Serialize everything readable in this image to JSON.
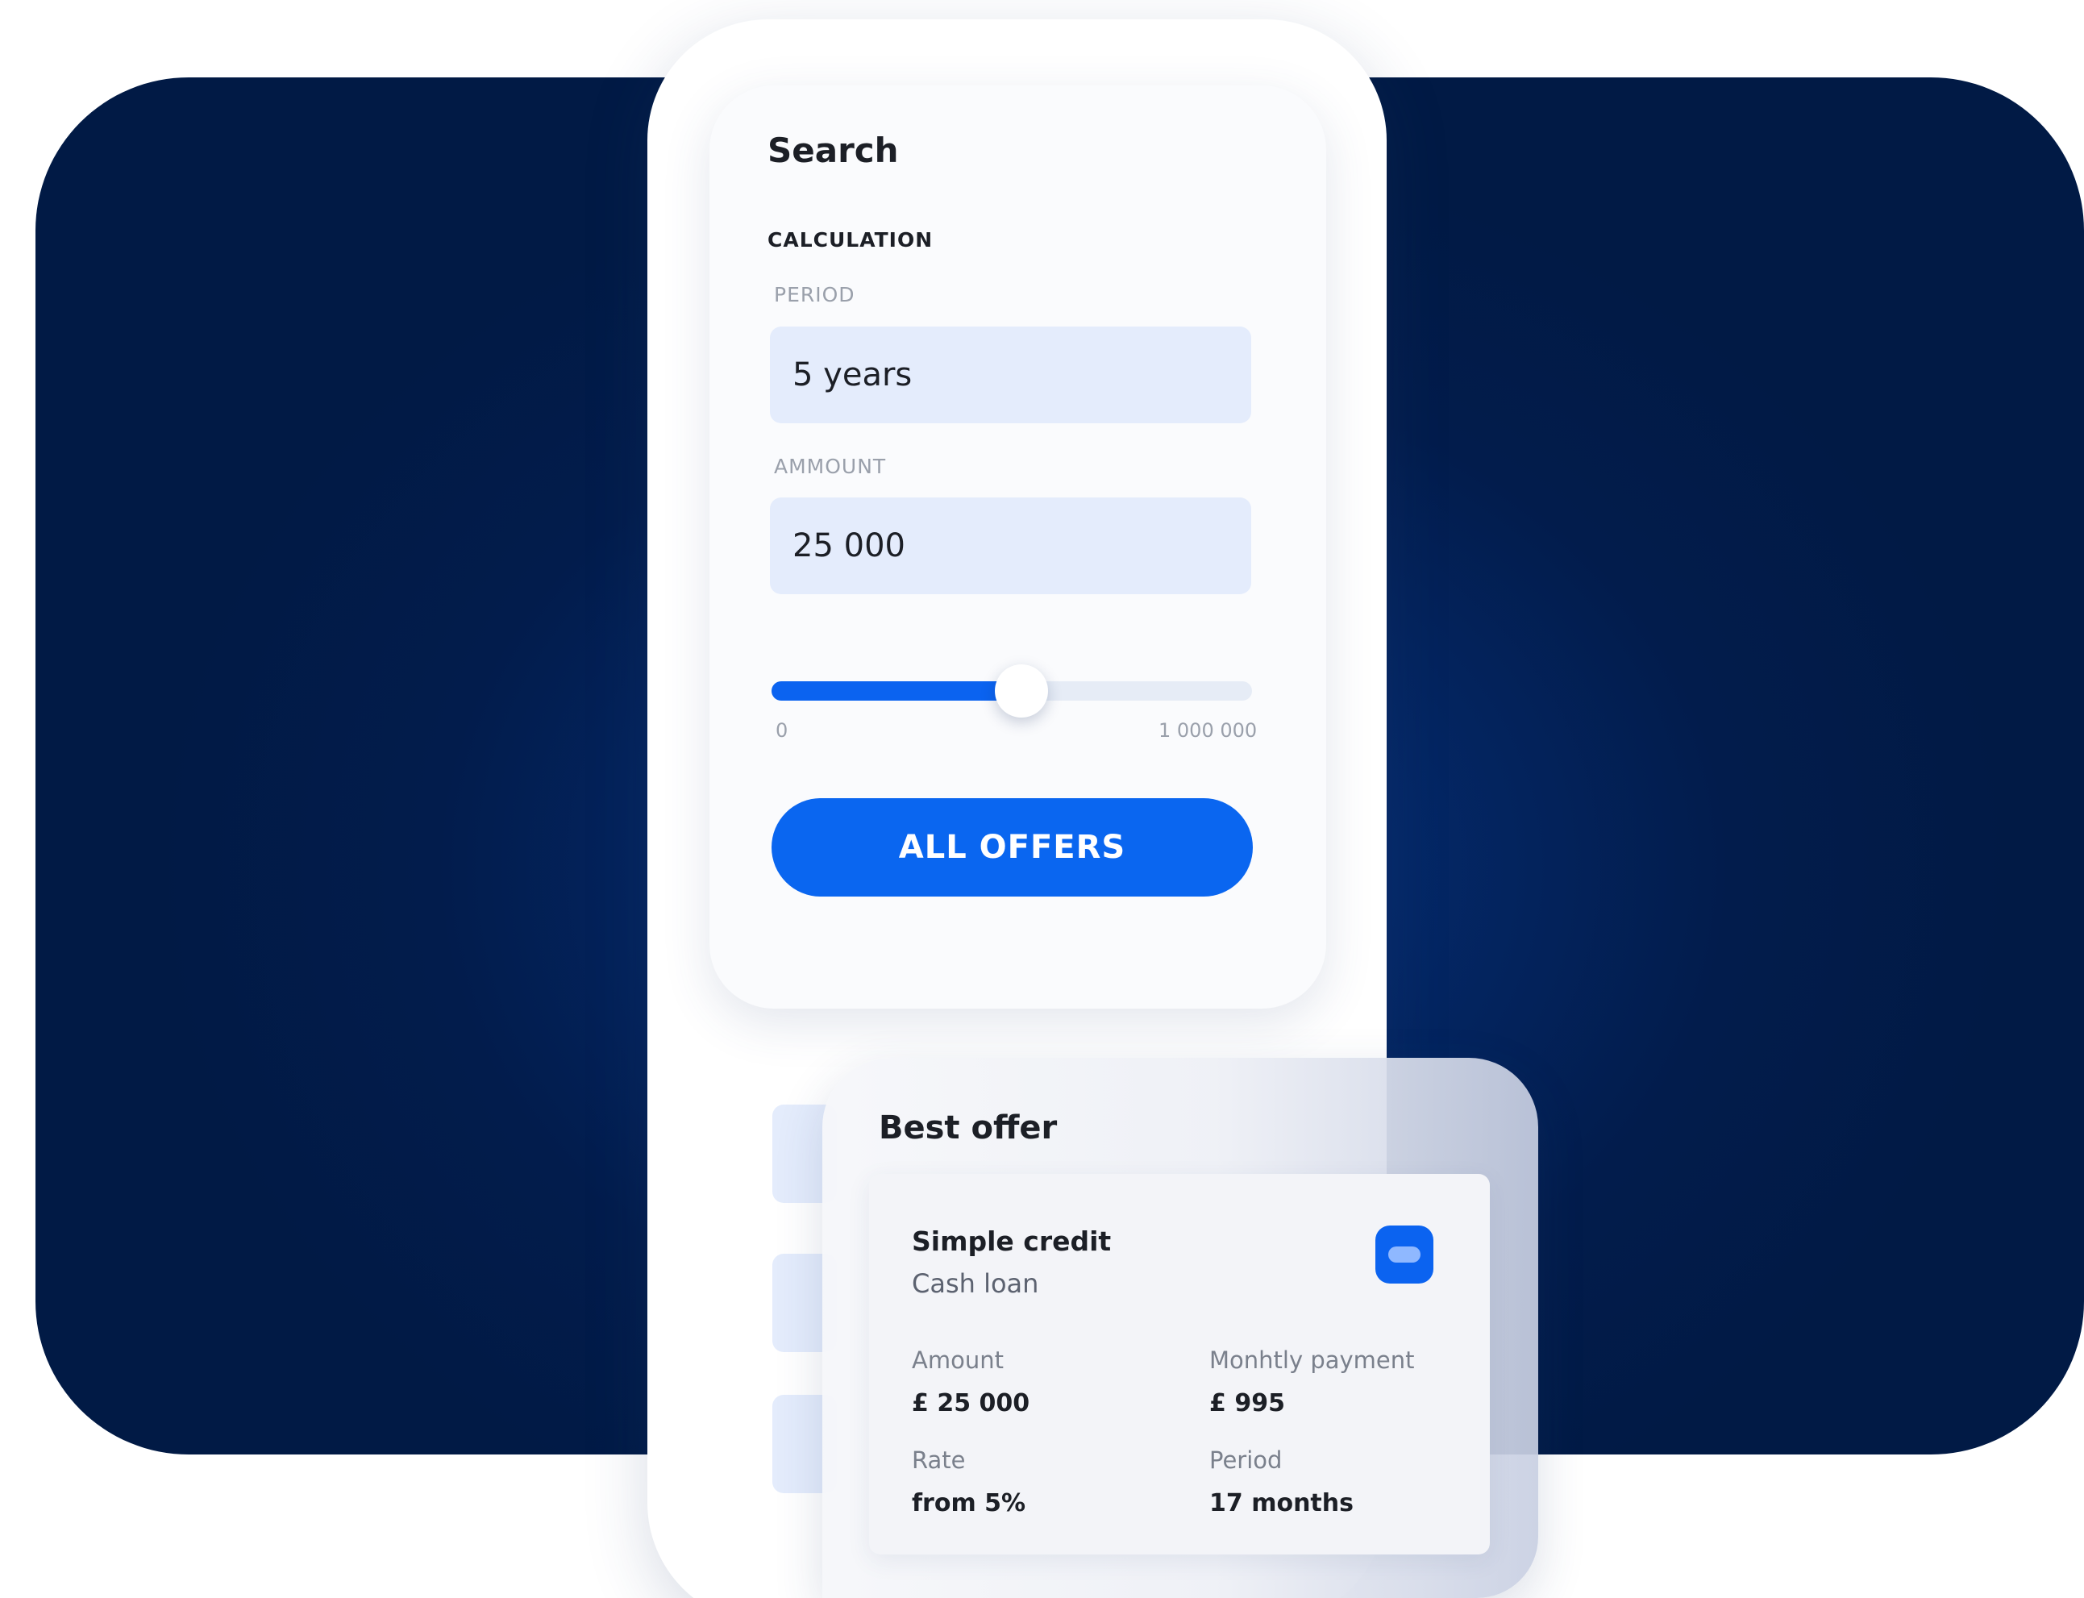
{
  "colors": {
    "background_navy": "#011a45",
    "accent_blue": "#0a66f0",
    "field_fill": "#e4ecfc"
  },
  "search": {
    "title": "Search",
    "section": "CALCULATION",
    "period_label": "PERIOD",
    "period_value": "5 years",
    "amount_label": "AMMOUNT",
    "amount_value": "25 000",
    "slider": {
      "min_label": "0",
      "max_label": "1 000 000",
      "fill_fraction": 0.52
    },
    "cta_label": "ALL OFFERS"
  },
  "best_offer": {
    "title": "Best offer",
    "icon": "card-icon",
    "offer": {
      "name": "Simple credit",
      "type": "Cash loan",
      "amount_label": "Amount",
      "amount_value": "£ 25 000",
      "payment_label": "Monhtly payment",
      "payment_value": "£ 995",
      "rate_label": "Rate",
      "rate_value": "from 5%",
      "period_label": "Period",
      "period_value": "17 months"
    }
  }
}
